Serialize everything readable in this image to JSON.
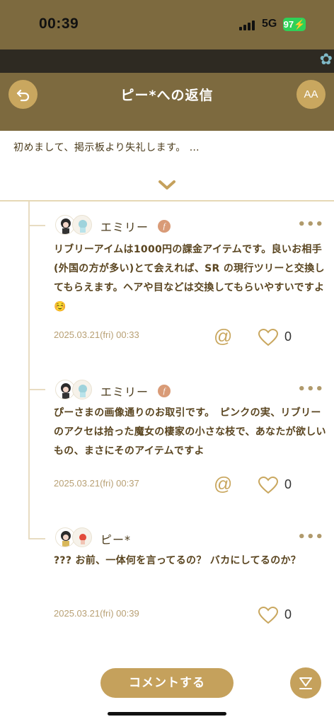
{
  "status": {
    "time": "00:39",
    "network": "5G",
    "battery": "97"
  },
  "header": {
    "title": "ピー*への返信",
    "font_size_label": "AA"
  },
  "original_post": {
    "text": "初めまして、掲示板より失礼します。 …"
  },
  "comments": [
    {
      "author": "エミリー",
      "badge": "f",
      "text": "リブリーアイムは1000円の課金アイテムです。良いお相手(外国の方が多い)とて会えれば、SR の現行ツリーと交換してもらえます。ヘアや目などは交換してもらいやすいですよ☺️",
      "date": "2025.03.21(fri) 00:33",
      "likes": "0",
      "mention": "@",
      "more": "•••"
    },
    {
      "author": "エミリー",
      "badge": "f",
      "text": "ぴーさまの画像通りのお取引です。　ピンクの実、リブリーのアクセは拾った魔女の棲家の小さな枝で、あなたが欲しいもの、まさにそのアイテムですよ",
      "date": "2025.03.21(fri) 00:37",
      "likes": "0",
      "mention": "@",
      "more": "•••"
    },
    {
      "author": "ピー*",
      "text": "??? お前、一体何を言ってるの？ バカにしてるのか？",
      "date": "2025.03.21(fri) 00:39",
      "likes": "0",
      "more": "•••"
    }
  ],
  "footer": {
    "comment_button": "コメントする"
  },
  "colors": {
    "header": "#7d6a3f",
    "accent": "#c5a15c",
    "badge": "#d99b77"
  }
}
